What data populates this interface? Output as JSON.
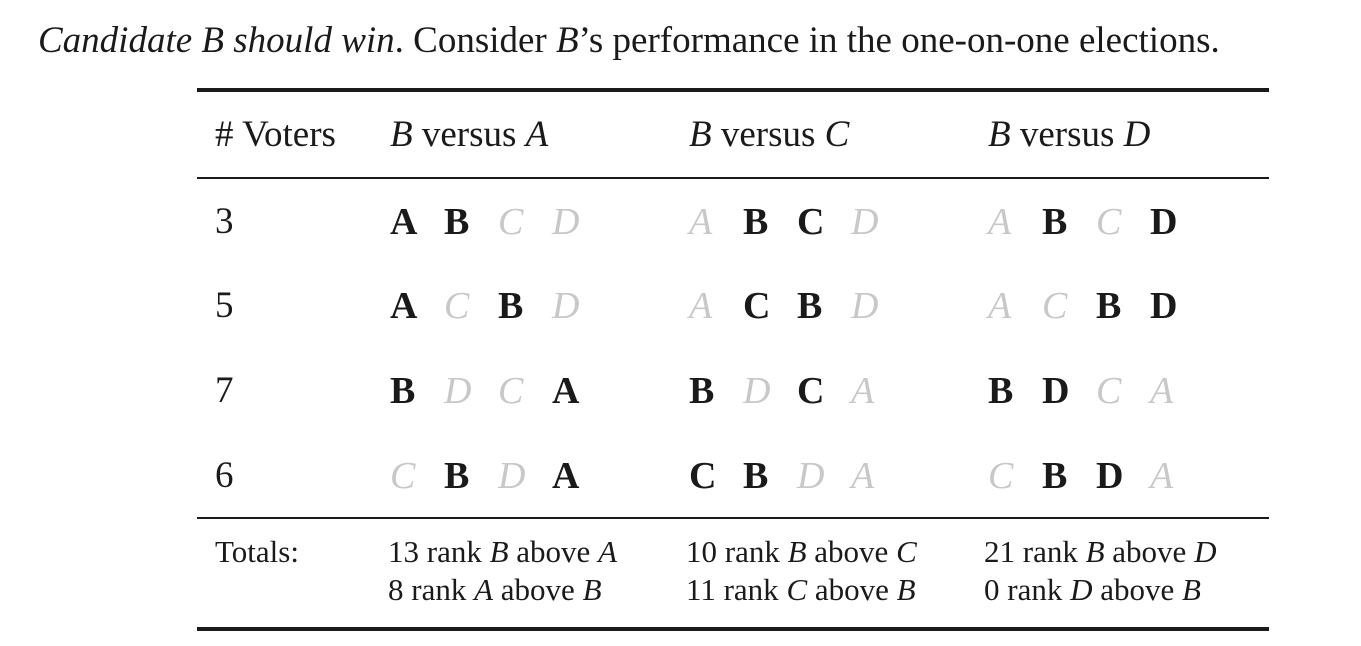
{
  "intro": {
    "italic_part": "Candidate B should win",
    "rest_prefix": ". Consider ",
    "rest_letter": "B",
    "rest_suffix": "’s performance in the one-on-one elections."
  },
  "header": {
    "voters_label": "# Voters",
    "columns": [
      {
        "left": "B",
        "middle": " versus ",
        "right": "A"
      },
      {
        "left": "B",
        "middle": " versus ",
        "right": "C"
      },
      {
        "left": "B",
        "middle": " versus ",
        "right": "D"
      }
    ]
  },
  "rows": [
    {
      "voters": "3",
      "rankings": [
        [
          {
            "letter": "A",
            "on": true
          },
          {
            "letter": "B",
            "on": true
          },
          {
            "letter": "C",
            "on": false
          },
          {
            "letter": "D",
            "on": false
          }
        ],
        [
          {
            "letter": "A",
            "on": false
          },
          {
            "letter": "B",
            "on": true
          },
          {
            "letter": "C",
            "on": true
          },
          {
            "letter": "D",
            "on": false
          }
        ],
        [
          {
            "letter": "A",
            "on": false
          },
          {
            "letter": "B",
            "on": true
          },
          {
            "letter": "C",
            "on": false
          },
          {
            "letter": "D",
            "on": true
          }
        ]
      ]
    },
    {
      "voters": "5",
      "rankings": [
        [
          {
            "letter": "A",
            "on": true
          },
          {
            "letter": "C",
            "on": false
          },
          {
            "letter": "B",
            "on": true
          },
          {
            "letter": "D",
            "on": false
          }
        ],
        [
          {
            "letter": "A",
            "on": false
          },
          {
            "letter": "C",
            "on": true
          },
          {
            "letter": "B",
            "on": true
          },
          {
            "letter": "D",
            "on": false
          }
        ],
        [
          {
            "letter": "A",
            "on": false
          },
          {
            "letter": "C",
            "on": false
          },
          {
            "letter": "B",
            "on": true
          },
          {
            "letter": "D",
            "on": true
          }
        ]
      ]
    },
    {
      "voters": "7",
      "rankings": [
        [
          {
            "letter": "B",
            "on": true
          },
          {
            "letter": "D",
            "on": false
          },
          {
            "letter": "C",
            "on": false
          },
          {
            "letter": "A",
            "on": true
          }
        ],
        [
          {
            "letter": "B",
            "on": true
          },
          {
            "letter": "D",
            "on": false
          },
          {
            "letter": "C",
            "on": true
          },
          {
            "letter": "A",
            "on": false
          }
        ],
        [
          {
            "letter": "B",
            "on": true
          },
          {
            "letter": "D",
            "on": true
          },
          {
            "letter": "C",
            "on": false
          },
          {
            "letter": "A",
            "on": false
          }
        ]
      ]
    },
    {
      "voters": "6",
      "rankings": [
        [
          {
            "letter": "C",
            "on": false
          },
          {
            "letter": "B",
            "on": true
          },
          {
            "letter": "D",
            "on": false
          },
          {
            "letter": "A",
            "on": true
          }
        ],
        [
          {
            "letter": "C",
            "on": true
          },
          {
            "letter": "B",
            "on": true
          },
          {
            "letter": "D",
            "on": false
          },
          {
            "letter": "A",
            "on": false
          }
        ],
        [
          {
            "letter": "C",
            "on": false
          },
          {
            "letter": "B",
            "on": true
          },
          {
            "letter": "D",
            "on": true
          },
          {
            "letter": "A",
            "on": false
          }
        ]
      ]
    }
  ],
  "totals": {
    "label": "Totals:",
    "columns": [
      [
        {
          "count": "13 rank ",
          "first": "B",
          "mid": " above ",
          "second": "A"
        },
        {
          "count": "8 rank ",
          "first": "A",
          "mid": " above ",
          "second": "B"
        }
      ],
      [
        {
          "count": "10 rank ",
          "first": "B",
          "mid": " above ",
          "second": "C"
        },
        {
          "count": "11 rank ",
          "first": "C",
          "mid": " above ",
          "second": "B"
        }
      ],
      [
        {
          "count": "21 rank ",
          "first": "B",
          "mid": " above ",
          "second": "D"
        },
        {
          "count": "0 rank ",
          "first": "D",
          "mid": " above ",
          "second": "B"
        }
      ]
    ]
  },
  "colors": {
    "text": "#1a1a1a",
    "faded_candidate": "#c8c8c8"
  }
}
